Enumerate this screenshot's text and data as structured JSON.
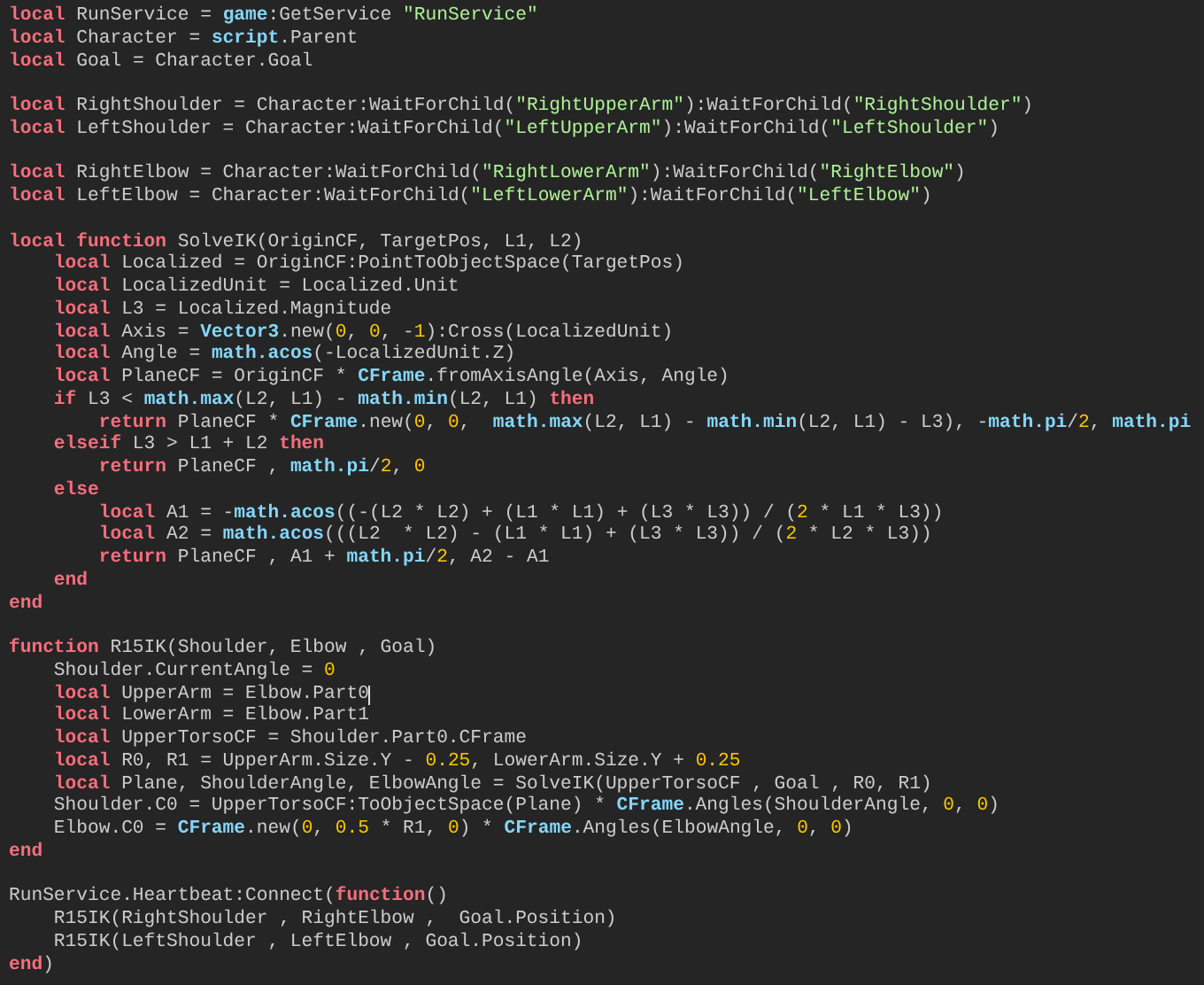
{
  "editor": {
    "lines": [
      {
        "kind": "code",
        "tokens": [
          {
            "text": "local",
            "kind": "keyword"
          },
          {
            "text": " RunService = ",
            "kind": "plain"
          },
          {
            "text": "game",
            "kind": "builtin"
          },
          {
            "text": ":GetService ",
            "kind": "plain"
          },
          {
            "text": "\"RunService\"",
            "kind": "string"
          }
        ]
      },
      {
        "kind": "code",
        "tokens": [
          {
            "text": "local",
            "kind": "keyword"
          },
          {
            "text": " Character = ",
            "kind": "plain"
          },
          {
            "text": "script",
            "kind": "builtin"
          },
          {
            "text": ".Parent",
            "kind": "plain"
          }
        ]
      },
      {
        "kind": "code",
        "tokens": [
          {
            "text": "local",
            "kind": "keyword"
          },
          {
            "text": " Goal = Character.Goal",
            "kind": "plain"
          }
        ]
      },
      {
        "kind": "blank"
      },
      {
        "kind": "code",
        "tokens": [
          {
            "text": "local",
            "kind": "keyword"
          },
          {
            "text": " RightShoulder = Character:WaitForChild(",
            "kind": "plain"
          },
          {
            "text": "\"RightUpperArm\"",
            "kind": "string"
          },
          {
            "text": "):WaitForChild(",
            "kind": "plain"
          },
          {
            "text": "\"RightShoulder\"",
            "kind": "string"
          },
          {
            "text": ")",
            "kind": "plain"
          }
        ]
      },
      {
        "kind": "code",
        "tokens": [
          {
            "text": "local",
            "kind": "keyword"
          },
          {
            "text": " LeftShoulder = Character:WaitForChild(",
            "kind": "plain"
          },
          {
            "text": "\"LeftUpperArm\"",
            "kind": "string"
          },
          {
            "text": "):WaitForChild(",
            "kind": "plain"
          },
          {
            "text": "\"LeftShoulder\"",
            "kind": "string"
          },
          {
            "text": ")",
            "kind": "plain"
          }
        ]
      },
      {
        "kind": "blank"
      },
      {
        "kind": "code",
        "tokens": [
          {
            "text": "local",
            "kind": "keyword"
          },
          {
            "text": " RightElbow = Character:WaitForChild(",
            "kind": "plain"
          },
          {
            "text": "\"RightLowerArm\"",
            "kind": "string"
          },
          {
            "text": "):WaitForChild(",
            "kind": "plain"
          },
          {
            "text": "\"RightElbow\"",
            "kind": "string"
          },
          {
            "text": ")",
            "kind": "plain"
          }
        ]
      },
      {
        "kind": "code",
        "tokens": [
          {
            "text": "local",
            "kind": "keyword"
          },
          {
            "text": " LeftElbow = Character:WaitForChild(",
            "kind": "plain"
          },
          {
            "text": "\"LeftLowerArm\"",
            "kind": "string"
          },
          {
            "text": "):WaitForChild(",
            "kind": "plain"
          },
          {
            "text": "\"LeftElbow\"",
            "kind": "string"
          },
          {
            "text": ")",
            "kind": "plain"
          }
        ]
      },
      {
        "kind": "blank"
      },
      {
        "kind": "code",
        "tokens": [
          {
            "text": "local function",
            "kind": "keyword"
          },
          {
            "text": " SolveIK(OriginCF, TargetPos, L1, L2)",
            "kind": "plain"
          }
        ]
      },
      {
        "kind": "code",
        "tokens": [
          {
            "text": "    local",
            "kind": "keyword"
          },
          {
            "text": " Localized = OriginCF:PointToObjectSpace(TargetPos)",
            "kind": "plain"
          }
        ]
      },
      {
        "kind": "code",
        "tokens": [
          {
            "text": "    local",
            "kind": "keyword"
          },
          {
            "text": " LocalizedUnit = Localized.Unit",
            "kind": "plain"
          }
        ]
      },
      {
        "kind": "code",
        "tokens": [
          {
            "text": "    local",
            "kind": "keyword"
          },
          {
            "text": " L3 = Localized.Magnitude",
            "kind": "plain"
          }
        ]
      },
      {
        "kind": "code",
        "tokens": [
          {
            "text": "    local",
            "kind": "keyword"
          },
          {
            "text": " Axis = ",
            "kind": "plain"
          },
          {
            "text": "Vector3",
            "kind": "builtin"
          },
          {
            "text": ".new(",
            "kind": "plain"
          },
          {
            "text": "0",
            "kind": "number"
          },
          {
            "text": ", ",
            "kind": "plain"
          },
          {
            "text": "0",
            "kind": "number"
          },
          {
            "text": ", -",
            "kind": "plain"
          },
          {
            "text": "1",
            "kind": "number"
          },
          {
            "text": "):Cross(LocalizedUnit)",
            "kind": "plain"
          }
        ]
      },
      {
        "kind": "code",
        "tokens": [
          {
            "text": "    local",
            "kind": "keyword"
          },
          {
            "text": " Angle = ",
            "kind": "plain"
          },
          {
            "text": "math.acos",
            "kind": "builtin"
          },
          {
            "text": "(-LocalizedUnit.Z)",
            "kind": "plain"
          }
        ]
      },
      {
        "kind": "code",
        "tokens": [
          {
            "text": "    local",
            "kind": "keyword"
          },
          {
            "text": " PlaneCF = OriginCF * ",
            "kind": "plain"
          },
          {
            "text": "CFrame",
            "kind": "builtin"
          },
          {
            "text": ".fromAxisAngle(Axis, Angle)",
            "kind": "plain"
          }
        ]
      },
      {
        "kind": "code",
        "tokens": [
          {
            "text": "    if",
            "kind": "keyword"
          },
          {
            "text": " L3 < ",
            "kind": "plain"
          },
          {
            "text": "math.max",
            "kind": "builtin"
          },
          {
            "text": "(L2, L1) - ",
            "kind": "plain"
          },
          {
            "text": "math.min",
            "kind": "builtin"
          },
          {
            "text": "(L2, L1) ",
            "kind": "plain"
          },
          {
            "text": "then",
            "kind": "keyword"
          }
        ]
      },
      {
        "kind": "code",
        "tokens": [
          {
            "text": "        return",
            "kind": "keyword"
          },
          {
            "text": " PlaneCF * ",
            "kind": "plain"
          },
          {
            "text": "CFrame",
            "kind": "builtin"
          },
          {
            "text": ".new(",
            "kind": "plain"
          },
          {
            "text": "0",
            "kind": "number"
          },
          {
            "text": ", ",
            "kind": "plain"
          },
          {
            "text": "0",
            "kind": "number"
          },
          {
            "text": ",  ",
            "kind": "plain"
          },
          {
            "text": "math.max",
            "kind": "builtin"
          },
          {
            "text": "(L2, L1) - ",
            "kind": "plain"
          },
          {
            "text": "math.min",
            "kind": "builtin"
          },
          {
            "text": "(L2, L1) - L3), -",
            "kind": "plain"
          },
          {
            "text": "math.pi",
            "kind": "builtin"
          },
          {
            "text": "/",
            "kind": "plain"
          },
          {
            "text": "2",
            "kind": "number"
          },
          {
            "text": ", ",
            "kind": "plain"
          },
          {
            "text": "math.pi",
            "kind": "builtin"
          }
        ]
      },
      {
        "kind": "code",
        "tokens": [
          {
            "text": "    elseif",
            "kind": "keyword"
          },
          {
            "text": " L3 > L1 + L2 ",
            "kind": "plain"
          },
          {
            "text": "then",
            "kind": "keyword"
          }
        ]
      },
      {
        "kind": "code",
        "tokens": [
          {
            "text": "        return",
            "kind": "keyword"
          },
          {
            "text": " PlaneCF , ",
            "kind": "plain"
          },
          {
            "text": "math.pi",
            "kind": "builtin"
          },
          {
            "text": "/",
            "kind": "plain"
          },
          {
            "text": "2",
            "kind": "number"
          },
          {
            "text": ", ",
            "kind": "plain"
          },
          {
            "text": "0",
            "kind": "number"
          }
        ]
      },
      {
        "kind": "code",
        "tokens": [
          {
            "text": "    else",
            "kind": "keyword"
          }
        ]
      },
      {
        "kind": "code",
        "tokens": [
          {
            "text": "        local",
            "kind": "keyword"
          },
          {
            "text": " A1 = -",
            "kind": "plain"
          },
          {
            "text": "math.acos",
            "kind": "builtin"
          },
          {
            "text": "((-(L2 * L2) + (L1 * L1) + (L3 * L3)) / (",
            "kind": "plain"
          },
          {
            "text": "2",
            "kind": "number"
          },
          {
            "text": " * L1 * L3))",
            "kind": "plain"
          }
        ]
      },
      {
        "kind": "code",
        "tokens": [
          {
            "text": "        local",
            "kind": "keyword"
          },
          {
            "text": " A2 = ",
            "kind": "plain"
          },
          {
            "text": "math.acos",
            "kind": "builtin"
          },
          {
            "text": "(((L2  * L2) - (L1 * L1) + (L3 * L3)) / (",
            "kind": "plain"
          },
          {
            "text": "2",
            "kind": "number"
          },
          {
            "text": " * L2 * L3))",
            "kind": "plain"
          }
        ]
      },
      {
        "kind": "code",
        "tokens": [
          {
            "text": "        return",
            "kind": "keyword"
          },
          {
            "text": " PlaneCF , A1 + ",
            "kind": "plain"
          },
          {
            "text": "math.pi",
            "kind": "builtin"
          },
          {
            "text": "/",
            "kind": "plain"
          },
          {
            "text": "2",
            "kind": "number"
          },
          {
            "text": ", A2 - A1",
            "kind": "plain"
          }
        ]
      },
      {
        "kind": "code",
        "tokens": [
          {
            "text": "    end",
            "kind": "keyword"
          }
        ]
      },
      {
        "kind": "code",
        "tokens": [
          {
            "text": "end",
            "kind": "keyword"
          }
        ]
      },
      {
        "kind": "blank"
      },
      {
        "kind": "code",
        "tokens": [
          {
            "text": "function",
            "kind": "keyword"
          },
          {
            "text": " R15IK(Shoulder, Elbow , Goal)",
            "kind": "plain"
          }
        ]
      },
      {
        "kind": "code",
        "tokens": [
          {
            "text": "    Shoulder.CurrentAngle = ",
            "kind": "plain"
          },
          {
            "text": "0",
            "kind": "number"
          }
        ]
      },
      {
        "kind": "code",
        "tokens": [
          {
            "text": "    local",
            "kind": "keyword"
          },
          {
            "text": " UpperArm = Elbow.Part0",
            "kind": "plain"
          },
          {
            "kind": "caret"
          }
        ]
      },
      {
        "kind": "code",
        "tokens": [
          {
            "text": "    local",
            "kind": "keyword"
          },
          {
            "text": " LowerArm = Elbow.Part1",
            "kind": "plain"
          }
        ]
      },
      {
        "kind": "code",
        "tokens": [
          {
            "text": "    local",
            "kind": "keyword"
          },
          {
            "text": " UpperTorsoCF = Shoulder.Part0.CFrame",
            "kind": "plain"
          }
        ]
      },
      {
        "kind": "code",
        "tokens": [
          {
            "text": "    local",
            "kind": "keyword"
          },
          {
            "text": " R0, R1 = UpperArm.Size.Y - ",
            "kind": "plain"
          },
          {
            "text": "0.25",
            "kind": "number"
          },
          {
            "text": ", LowerArm.Size.Y + ",
            "kind": "plain"
          },
          {
            "text": "0.25",
            "kind": "number"
          }
        ]
      },
      {
        "kind": "code",
        "tokens": [
          {
            "text": "    local",
            "kind": "keyword"
          },
          {
            "text": " Plane, ShoulderAngle, ElbowAngle = SolveIK(UpperTorsoCF , Goal , R0, R1)",
            "kind": "plain"
          }
        ]
      },
      {
        "kind": "code",
        "tokens": [
          {
            "text": "    Shoulder.C0 = UpperTorsoCF:ToObjectSpace(Plane) * ",
            "kind": "plain"
          },
          {
            "text": "CFrame",
            "kind": "builtin"
          },
          {
            "text": ".Angles(ShoulderAngle, ",
            "kind": "plain"
          },
          {
            "text": "0",
            "kind": "number"
          },
          {
            "text": ", ",
            "kind": "plain"
          },
          {
            "text": "0",
            "kind": "number"
          },
          {
            "text": ")",
            "kind": "plain"
          }
        ]
      },
      {
        "kind": "code",
        "tokens": [
          {
            "text": "    Elbow.C0 = ",
            "kind": "plain"
          },
          {
            "text": "CFrame",
            "kind": "builtin"
          },
          {
            "text": ".new(",
            "kind": "plain"
          },
          {
            "text": "0",
            "kind": "number"
          },
          {
            "text": ", ",
            "kind": "plain"
          },
          {
            "text": "0.5",
            "kind": "number"
          },
          {
            "text": " * R1, ",
            "kind": "plain"
          },
          {
            "text": "0",
            "kind": "number"
          },
          {
            "text": ") * ",
            "kind": "plain"
          },
          {
            "text": "CFrame",
            "kind": "builtin"
          },
          {
            "text": ".Angles(ElbowAngle, ",
            "kind": "plain"
          },
          {
            "text": "0",
            "kind": "number"
          },
          {
            "text": ", ",
            "kind": "plain"
          },
          {
            "text": "0",
            "kind": "number"
          },
          {
            "text": ")",
            "kind": "plain"
          }
        ]
      },
      {
        "kind": "code",
        "tokens": [
          {
            "text": "end",
            "kind": "keyword"
          }
        ]
      },
      {
        "kind": "blank"
      },
      {
        "kind": "code",
        "tokens": [
          {
            "text": "RunService.Heartbeat:Connect(",
            "kind": "plain"
          },
          {
            "text": "function",
            "kind": "keyword"
          },
          {
            "text": "()",
            "kind": "plain"
          }
        ]
      },
      {
        "kind": "code",
        "tokens": [
          {
            "text": "    R15IK(RightShoulder , RightElbow ,  Goal.Position)",
            "kind": "plain"
          }
        ]
      },
      {
        "kind": "code",
        "tokens": [
          {
            "text": "    R15IK(LeftShoulder , LeftElbow , Goal.Position)",
            "kind": "plain"
          }
        ]
      },
      {
        "kind": "code",
        "tokens": [
          {
            "text": "end",
            "kind": "keyword"
          },
          {
            "text": ")",
            "kind": "plain"
          }
        ]
      }
    ]
  }
}
